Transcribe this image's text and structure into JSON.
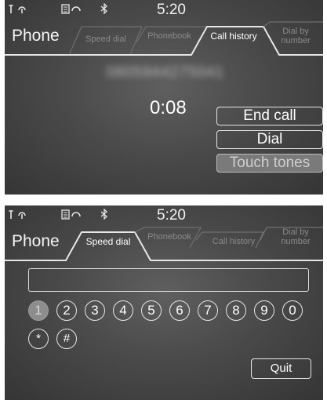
{
  "screens": [
    {
      "status": {
        "antenna_glyph": "Ĭ",
        "headset_glyph": "Ո",
        "phone_glyph": "▤",
        "headset2_glyph": "∩",
        "bluetooth_glyph": "✱",
        "time": "5:20"
      },
      "title": "Phone",
      "tabs": [
        "Speed dial",
        "Phonebook",
        "Call history",
        "Dial by\nnumber"
      ],
      "active_tab": "Call history",
      "number_display": "0805944275041",
      "call_timer": "0:08",
      "buttons": {
        "end_call": "End call",
        "dial": "Dial",
        "touch_tones": "Touch tones"
      }
    },
    {
      "status": {
        "antenna_glyph": "Ĭ",
        "headset_glyph": "Ո",
        "phone_glyph": "▤",
        "headset2_glyph": "∩",
        "bluetooth_glyph": "✱",
        "time": "5:20"
      },
      "title": "Phone",
      "tabs": [
        "Speed dial",
        "Phonebook",
        "Call history",
        "Dial by\nnumber"
      ],
      "active_tab": "Speed dial",
      "entry_value": "",
      "keys": [
        "1",
        "2",
        "3",
        "4",
        "5",
        "6",
        "7",
        "8",
        "9",
        "0"
      ],
      "extra_keys": [
        "*",
        "#"
      ],
      "selected_key": "1",
      "quit": "Quit"
    }
  ],
  "colors": {
    "screen_bg": "#4a4a4a",
    "active_text": "#ffffff",
    "inactive_text": "#8a8a8a"
  },
  "icons": [
    "antenna-icon",
    "headset-icon",
    "phone-battery-icon",
    "bluetooth-icon"
  ]
}
